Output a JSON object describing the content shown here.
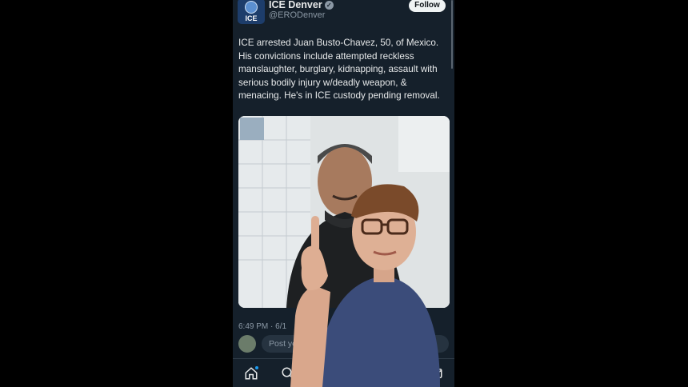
{
  "account": {
    "name": "ICE Denver",
    "handle": "@ERODenver",
    "avatar_text": "ICE",
    "follow_label": "Follow"
  },
  "tweet": {
    "text": "ICE arrested Juan Busto-Chavez, 50, of Mexico. His convictions include attempted reckless manslaughter, burglary, kidnapping, assault with serious bodily injury w/deadly weapon, & menacing. He's in ICE custody pending removal.",
    "timestamp": "6:49 PM · 6/1"
  },
  "reply": {
    "placeholder": "Post your reply"
  },
  "nav": {
    "items": [
      "home-icon",
      "search-icon",
      "grok-icon",
      "video-icon",
      "notifications-icon",
      "messages-icon"
    ]
  },
  "colors": {
    "background": "#15202b",
    "text": "#e7e9ea",
    "muted": "#8b98a5",
    "accent": "#1d9bf0"
  }
}
